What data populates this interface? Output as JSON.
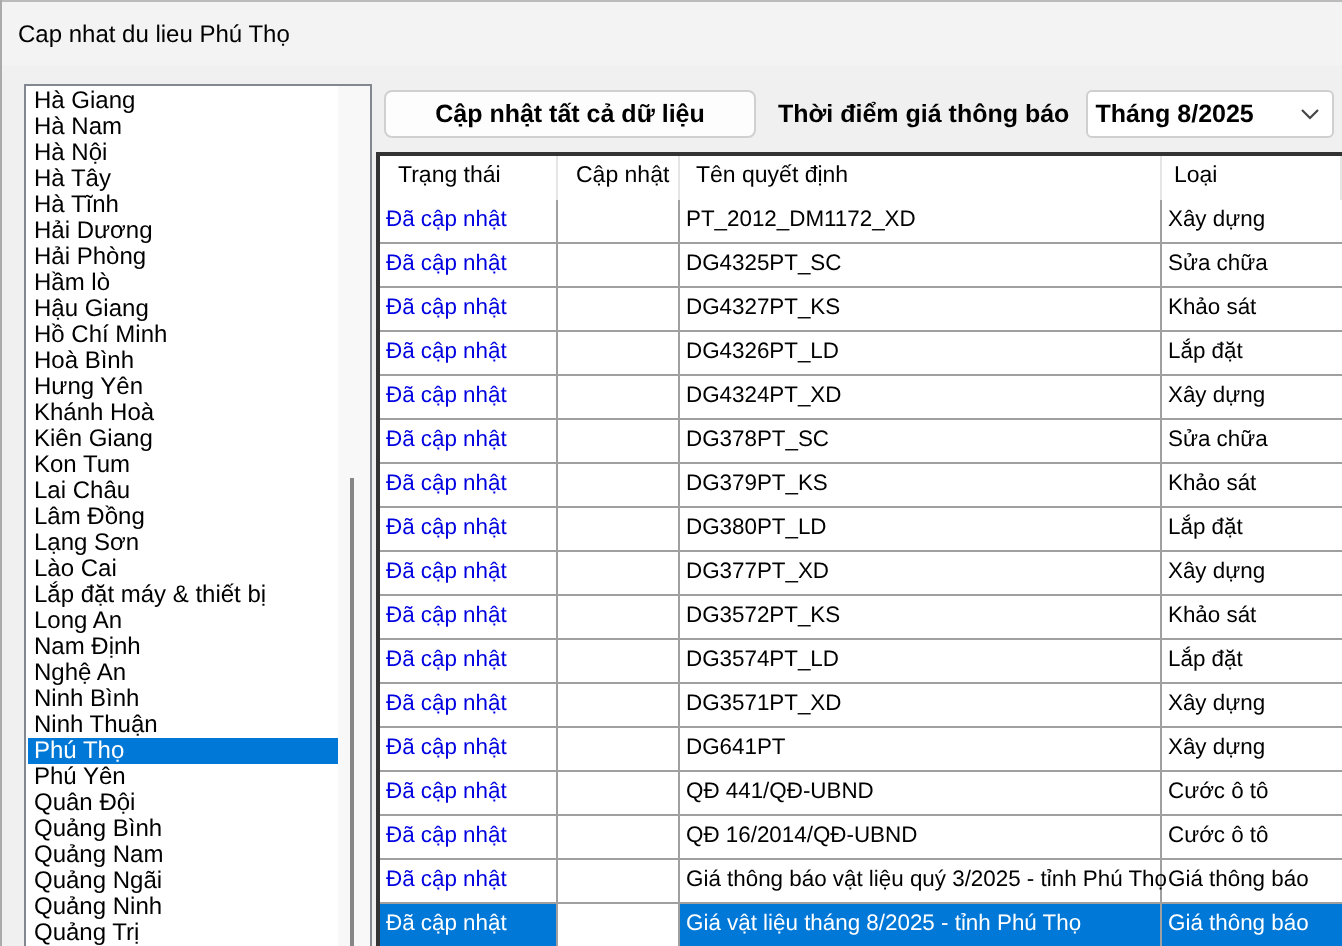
{
  "window": {
    "title": "Cap nhat du lieu Phú Thọ"
  },
  "provinces": [
    {
      "name": "Hà Giang",
      "selected": false
    },
    {
      "name": "Hà Nam",
      "selected": false
    },
    {
      "name": "Hà Nội",
      "selected": false
    },
    {
      "name": "Hà Tây",
      "selected": false
    },
    {
      "name": "Hà Tĩnh",
      "selected": false
    },
    {
      "name": "Hải Dương",
      "selected": false
    },
    {
      "name": "Hải Phòng",
      "selected": false
    },
    {
      "name": "Hầm lò",
      "selected": false
    },
    {
      "name": "Hậu Giang",
      "selected": false
    },
    {
      "name": "Hồ Chí Minh",
      "selected": false
    },
    {
      "name": "Hoà Bình",
      "selected": false
    },
    {
      "name": "Hưng Yên",
      "selected": false
    },
    {
      "name": "Khánh Hoà",
      "selected": false
    },
    {
      "name": "Kiên Giang",
      "selected": false
    },
    {
      "name": "Kon Tum",
      "selected": false
    },
    {
      "name": "Lai Châu",
      "selected": false
    },
    {
      "name": "Lâm Đồng",
      "selected": false
    },
    {
      "name": "Lạng Sơn",
      "selected": false
    },
    {
      "name": "Lào Cai",
      "selected": false
    },
    {
      "name": "Lắp đặt máy & thiết bị",
      "selected": false
    },
    {
      "name": "Long An",
      "selected": false
    },
    {
      "name": "Nam Định",
      "selected": false
    },
    {
      "name": "Nghệ An",
      "selected": false
    },
    {
      "name": "Ninh Bình",
      "selected": false
    },
    {
      "name": "Ninh Thuận",
      "selected": false
    },
    {
      "name": "Phú Thọ",
      "selected": true
    },
    {
      "name": "Phú Yên",
      "selected": false
    },
    {
      "name": "Quân Đội",
      "selected": false
    },
    {
      "name": "Quảng Bình",
      "selected": false
    },
    {
      "name": "Quảng Nam",
      "selected": false
    },
    {
      "name": "Quảng Ngãi",
      "selected": false
    },
    {
      "name": "Quảng Ninh",
      "selected": false
    },
    {
      "name": "Quảng Trị",
      "selected": false
    }
  ],
  "update_all_button": "Cập nhật tất cả dữ liệu",
  "price_time": {
    "label": "Thời điểm giá thông báo",
    "value": "Tháng 8/2025"
  },
  "table": {
    "columns": [
      "Trạng thái",
      "Cập nhật",
      "Tên quyết định",
      "Loại"
    ],
    "rows": [
      {
        "status": "Đã cập nhật",
        "name": "PT_2012_DM1172_XD",
        "type": "Xây dựng",
        "selected": false
      },
      {
        "status": "Đã cập nhật",
        "name": "DG4325PT_SC",
        "type": "Sửa chữa",
        "selected": false
      },
      {
        "status": "Đã cập nhật",
        "name": "DG4327PT_KS",
        "type": "Khảo sát",
        "selected": false
      },
      {
        "status": "Đã cập nhật",
        "name": "DG4326PT_LD",
        "type": "Lắp đặt",
        "selected": false
      },
      {
        "status": "Đã cập nhật",
        "name": "DG4324PT_XD",
        "type": "Xây dựng",
        "selected": false
      },
      {
        "status": "Đã cập nhật",
        "name": "DG378PT_SC",
        "type": "Sửa chữa",
        "selected": false
      },
      {
        "status": "Đã cập nhật",
        "name": "DG379PT_KS",
        "type": "Khảo sát",
        "selected": false
      },
      {
        "status": "Đã cập nhật",
        "name": "DG380PT_LD",
        "type": "Lắp đặt",
        "selected": false
      },
      {
        "status": "Đã cập nhật",
        "name": "DG377PT_XD",
        "type": "Xây dựng",
        "selected": false
      },
      {
        "status": "Đã cập nhật",
        "name": "DG3572PT_KS",
        "type": "Khảo sát",
        "selected": false
      },
      {
        "status": "Đã cập nhật",
        "name": "DG3574PT_LD",
        "type": "Lắp đặt",
        "selected": false
      },
      {
        "status": "Đã cập nhật",
        "name": "DG3571PT_XD",
        "type": "Xây dựng",
        "selected": false
      },
      {
        "status": "Đã cập nhật",
        "name": "DG641PT",
        "type": "Xây dựng",
        "selected": false
      },
      {
        "status": "Đã cập nhật",
        "name": "QĐ 441/QĐ-UBND",
        "type": "Cước ô tô",
        "selected": false
      },
      {
        "status": "Đã cập nhật",
        "name": "QĐ 16/2014/QĐ-UBND",
        "type": "Cước ô tô",
        "selected": false
      },
      {
        "status": "Đã cập nhật",
        "name": "Giá thông báo vật liệu quý 3/2025 - tỉnh Phú Thọ",
        "type": "Giá thông báo",
        "selected": false
      },
      {
        "status": "Đã cập nhật",
        "name": "Giá vật liệu tháng 8/2025 - tỉnh Phú Thọ",
        "type": "Giá thông báo",
        "selected": true
      }
    ]
  }
}
